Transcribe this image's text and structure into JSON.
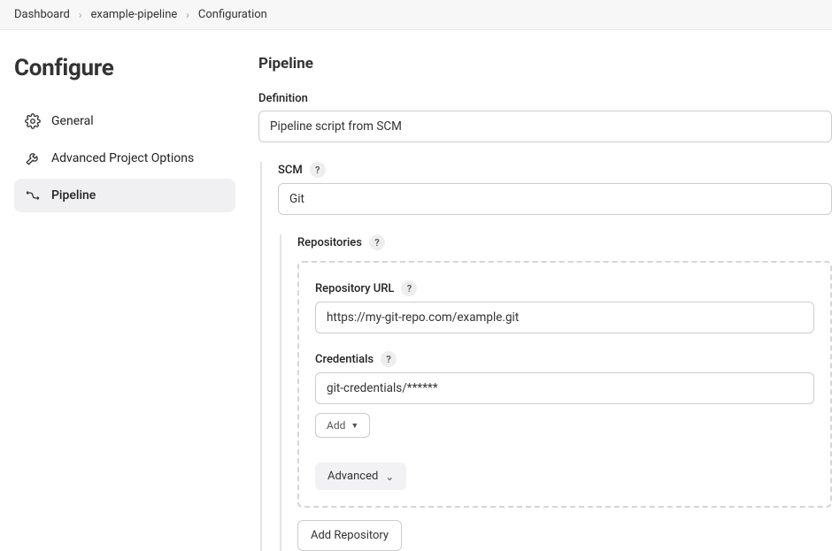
{
  "breadcrumb": {
    "items": [
      "Dashboard",
      "example-pipeline",
      "Configuration"
    ]
  },
  "sidebar": {
    "title": "Configure",
    "nav": [
      {
        "label": "General",
        "active": false
      },
      {
        "label": "Advanced Project Options",
        "active": false
      },
      {
        "label": "Pipeline",
        "active": true
      }
    ]
  },
  "content": {
    "heading": "Pipeline",
    "definition": {
      "label": "Definition",
      "value": "Pipeline script from SCM"
    },
    "scm": {
      "label": "SCM",
      "value": "Git"
    },
    "repositories": {
      "label": "Repositories",
      "repo_url": {
        "label": "Repository URL",
        "value": "https://my-git-repo.com/example.git"
      },
      "credentials": {
        "label": "Credentials",
        "value": "git-credentials/******"
      },
      "add_dropdown_label": "Add",
      "advanced_label": "Advanced",
      "add_repo_label": "Add Repository"
    }
  }
}
